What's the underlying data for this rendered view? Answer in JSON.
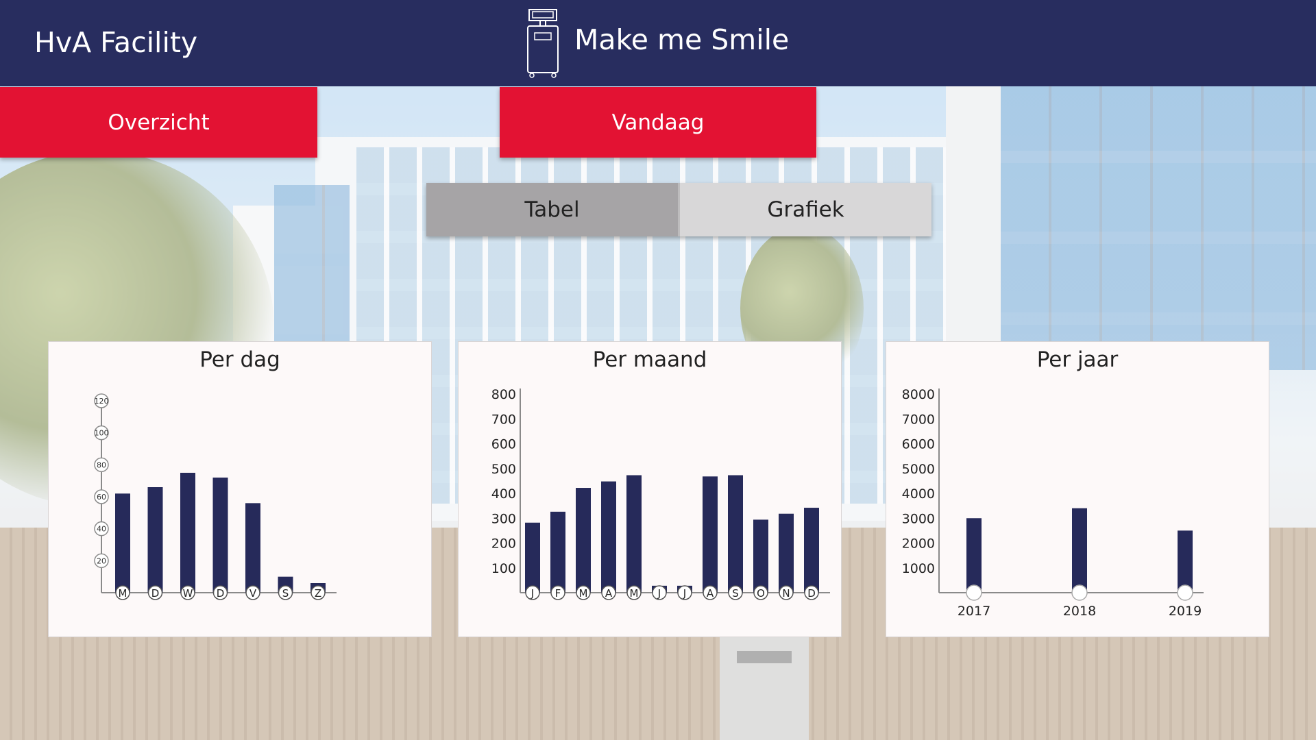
{
  "header": {
    "brand": "HvA Facility",
    "app_title": "Make me Smile",
    "icon": "kiosk-device-icon",
    "background_color": "#282d5f"
  },
  "nav": {
    "overzicht_label": "Overzicht",
    "vandaag_label": "Vandaag",
    "accent_color": "#e31233"
  },
  "view_toggle": {
    "tabel_label": "Tabel",
    "grafiek_label": "Grafiek",
    "selected": "Tabel"
  },
  "chart_data": [
    {
      "type": "bar",
      "title": "Per dag",
      "categories": [
        "M",
        "D",
        "W",
        "D",
        "V",
        "S",
        "Z"
      ],
      "values": [
        62,
        66,
        75,
        72,
        56,
        10,
        6
      ],
      "yticks": [
        "20",
        "40",
        "60",
        "80",
        "100",
        "120"
      ],
      "ylim": [
        0,
        120
      ],
      "color": "#262a5a"
    },
    {
      "type": "bar",
      "title": "Per maand",
      "categories": [
        "J",
        "F",
        "M",
        "A",
        "M",
        "J",
        "J",
        "A",
        "S",
        "O",
        "N",
        "D"
      ],
      "values": [
        282,
        326,
        422,
        448,
        473,
        28,
        28,
        468,
        473,
        294,
        318,
        342
      ],
      "yticks": [
        "100",
        "200",
        "300",
        "400",
        "500",
        "600",
        "700",
        "800"
      ],
      "ylim": [
        0,
        800
      ],
      "color": "#262a5a"
    },
    {
      "type": "bar",
      "title": "Per jaar",
      "categories": [
        "2017",
        "2018",
        "2019"
      ],
      "values": [
        3000,
        3400,
        2500
      ],
      "yticks": [
        "1000",
        "2000",
        "3000",
        "4000",
        "5000",
        "6000",
        "7000",
        "8000"
      ],
      "ylim": [
        0,
        8000
      ],
      "color": "#262a5a"
    }
  ]
}
